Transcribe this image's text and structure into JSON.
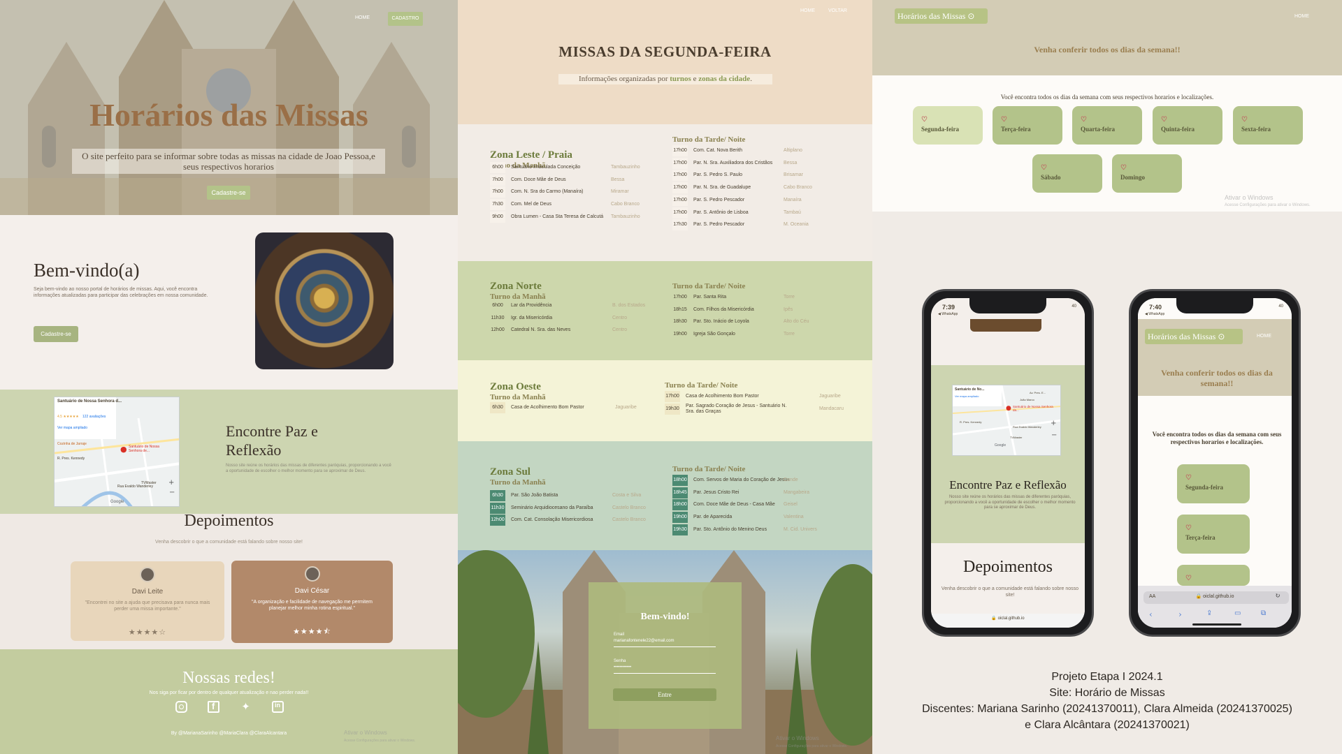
{
  "hero": {
    "nav": [
      "HOME",
      "CADASTRO"
    ],
    "title": "Horários das Missas",
    "subtitle": "O site perfeito para se informar sobre todas as missas na cidade de Joao Pessoa,e seus respectivos horarios",
    "cta": "Cadastre-se"
  },
  "welcome": {
    "title": "Bem-vindo(a)",
    "text": "Seja bem-vindo ao nosso portal de horários de missas. Aqui, você encontra informações atualizadas para participar das celebrações em nossa comunidade.",
    "cta": "Cadastre-se"
  },
  "map": {
    "place": "Santuário de Nossa Senhora d...",
    "link": "Ver mapa ampliado",
    "rating": "4.5",
    "stars": "★★★★★",
    "reviews": "122 avaliações",
    "pin": "Santuário de Nossa Senhora de...",
    "labels": [
      "Cozinha de Jarraje",
      "R. Pres. Kennedy",
      "Rua Evaldo Wanderley",
      "TVMaster",
      "Google"
    ]
  },
  "peace": {
    "title": "Encontre Paz e Reflexão",
    "text": "Nosso site reúne os horários das missas de diferentes paróquias, proporcionando a você a oportunidade de escolher o melhor momento para se aproximar de Deus."
  },
  "testimonials": {
    "title": "Depoimentos",
    "subtitle": "Venha descobrir o que a comunidade está falando sobre nosso site!",
    "items": [
      {
        "name": "Davi Leite",
        "quote": "\"Encontrei no site a ajuda que precisava para nunca mais perder uma missa importante.\"",
        "stars": "★★★★☆"
      },
      {
        "name": "Davi César",
        "quote": "\"A organização e facilidade de navegação me permitem planejar melhor minha rotina espiritual.\"",
        "stars": "★★★★⯪"
      }
    ]
  },
  "social": {
    "title": "Nossas redes!",
    "subtitle": "Nos siga por ficar por dentro de qualquer atualização e nao perder nada!!",
    "icons": [
      "instagram-icon",
      "facebook-icon",
      "twitter-icon",
      "linkedin-icon"
    ],
    "credit": "By @MarianaSarinho @MariaClara @ClaraAlcantara"
  },
  "watermark": {
    "line1": "Ativar o Windows",
    "line2": "Acesse Configurações para ativar o Windows."
  },
  "schedule": {
    "nav": [
      "HOME",
      "VOLTAR"
    ],
    "title": "MISSAS DA SEGUNDA-FEIRA",
    "subtitle_pre": "Informações organizadas por ",
    "subtitle_b1": "turnos",
    "subtitle_mid": " e ",
    "subtitle_b2": "zonas da cidade",
    "subtitle_post": ".",
    "morning": "Turno da Manhã",
    "afternoon": "Turno da Tarde/ Noite",
    "zones": [
      {
        "name": "Zona Leste / Praia",
        "morning": [
          [
            "6h00",
            "Santuário Imaculada Conceição",
            "Tambauzinho"
          ],
          [
            "7h00",
            "Com. Doce Mãe de Deus",
            "Bessa"
          ],
          [
            "7h00",
            "Com. N. Sra do Carmo (Manaíra)",
            "Miramar"
          ],
          [
            "7h30",
            "Com. Mel de Deus",
            "Cabo Branco"
          ],
          [
            "9h00",
            "Obra Lumen - Casa Sta Teresa de Calcutá",
            "Tambauzinho"
          ]
        ],
        "afternoon": [
          [
            "17h00",
            "Com. Cat. Nova Berith",
            "Altiplano"
          ],
          [
            "17h00",
            "Par. N. Sra. Auxiliadora dos Cristãos",
            "Bessa"
          ],
          [
            "17h00",
            "Par. S. Pedro S. Paulo",
            "Brisamar"
          ],
          [
            "17h00",
            "Par. N. Sra. de Guadalupe",
            "Cabo Branco"
          ],
          [
            "17h00",
            "Par. S. Pedro Pescador",
            "Manaíra"
          ],
          [
            "17h00",
            "Par. S. Antônio de Lisboa",
            "Tambaú"
          ],
          [
            "17h30",
            "Par. S. Pedro Pescador",
            "M. Oceania"
          ]
        ]
      },
      {
        "name": "Zona Norte",
        "morning": [
          [
            "6h00",
            "Lar da Providência",
            "B. dos Estados"
          ],
          [
            "11h30",
            "Igr. da Misericórdia",
            "Centro"
          ],
          [
            "12h00",
            "Catedral N. Sra. das Neves",
            "Centro"
          ]
        ],
        "afternoon": [
          [
            "17h00",
            "Par. Santa Rita",
            "Torre"
          ],
          [
            "18h15",
            "Com. Filhos da Misericórdia",
            "Ipês"
          ],
          [
            "18h30",
            "Par. Sto. Inácio de Loyola",
            "Alto do Céu"
          ],
          [
            "19h00",
            "Igreja São Gonçalo",
            "Torre"
          ]
        ]
      },
      {
        "name": "Zona Oeste",
        "morning": [
          [
            "6h30",
            "Casa de Acolhimento Bom Pastor",
            "Jaguaribe"
          ]
        ],
        "afternoon": [
          [
            "17h00",
            "Casa de Acolhimento Bom Pastor",
            "Jaguaribe"
          ],
          [
            "19h30",
            "Par. Sagrado Coração de Jesus - Santuário N. Sra. das Graças",
            "Mandacaru"
          ]
        ]
      },
      {
        "name": "Zona Sul",
        "morning": [
          [
            "6h30",
            "Par. São João Batista",
            "Costa e Silva"
          ],
          [
            "11h30",
            "Seminário Arquidiocesano da Paraíba",
            "Castelo Branco"
          ],
          [
            "12h00",
            "Com. Cat. Consolação Misericordiosa",
            "Castelo Branco"
          ]
        ],
        "afternoon": [
          [
            "18h00",
            "Com. Servos de Maria do Coração de Jesus",
            "Conde"
          ],
          [
            "18h45",
            "Par. Jesus Cristo Rei",
            "Mangabeira"
          ],
          [
            "18h00",
            "Com. Doce Mãe de Deus - Casa Mãe",
            "Geisel"
          ],
          [
            "19h00",
            "Par. de Aparecida",
            "Valentina"
          ],
          [
            "19h30",
            "Par. Sto. Antônio do Menino Deus",
            "M. Cid. Univers"
          ]
        ]
      }
    ]
  },
  "login": {
    "title": "Bem-vindo!",
    "email_label": "Email",
    "email_value": "marianafontenele22@email.com",
    "password_label": "Senha",
    "password_value": "••••••••••••",
    "submit": "Entre"
  },
  "days": {
    "logo": "Horários das Missas",
    "nav": "HOME",
    "header": "Venha conferir todos os dias da semana!!",
    "intro": "Você encontra todos os dias da semana com seus respectivos horarios e localizações.",
    "items": [
      "Segunda-feira",
      "Terça-feira",
      "Quarta-feira",
      "Quinta-feira",
      "Sexta-feira",
      "Sábado",
      "Domingo"
    ]
  },
  "phone1": {
    "time": "7:39",
    "back": "◀ WhatsApp",
    "signal": "40",
    "map_place": "Santuário de No...",
    "map_link": "Ver mapa ampliado",
    "map_pin": "Santuário de Nossa Senhora da...",
    "map_labels": [
      "Av. Pres. E...",
      "João Marco",
      "R. Pres. Kennedy",
      "Rua Evaldo Wanderley",
      "TVMaster",
      "Google"
    ],
    "peace_title": "Encontre Paz e Reflexão",
    "peace_text": "Nosso site reúne os horários das missas de diferentes paróquias, proporcionando a você a oportunidade de escolher o melhor momento para se aproximar de Deus.",
    "dep_title": "Depoimentos",
    "dep_sub": "Venha descobrir o que a comunidade está falando sobre nosso site!",
    "url": "oiclal.github.io"
  },
  "phone2": {
    "time": "7:40",
    "back": "◀ WhatsApp",
    "signal": "40",
    "logo": "Horários das Missas",
    "nav": "HOME",
    "header": "Venha conferir todos os dias da semana!!",
    "intro": "Você encontra todos os dias da semana com seus respectivos horarios e localizações.",
    "days": [
      "Segunda-feira",
      "Terça-feira"
    ],
    "aa": "AA",
    "url": "oiclal.github.io"
  },
  "project": {
    "line1": "Projeto Etapa I 2024.1",
    "line2": "Site: Horário de Missas",
    "line3": "Discentes: Mariana Sarinho (20241370011), Clara Almeida (20241370025)",
    "line4": "e Clara Alcântara (20241370021)"
  },
  "colors": {
    "green": "#b3c389",
    "sand": "#eedcc6",
    "brown": "#9a6f47",
    "sage": "#cdd5b1"
  }
}
